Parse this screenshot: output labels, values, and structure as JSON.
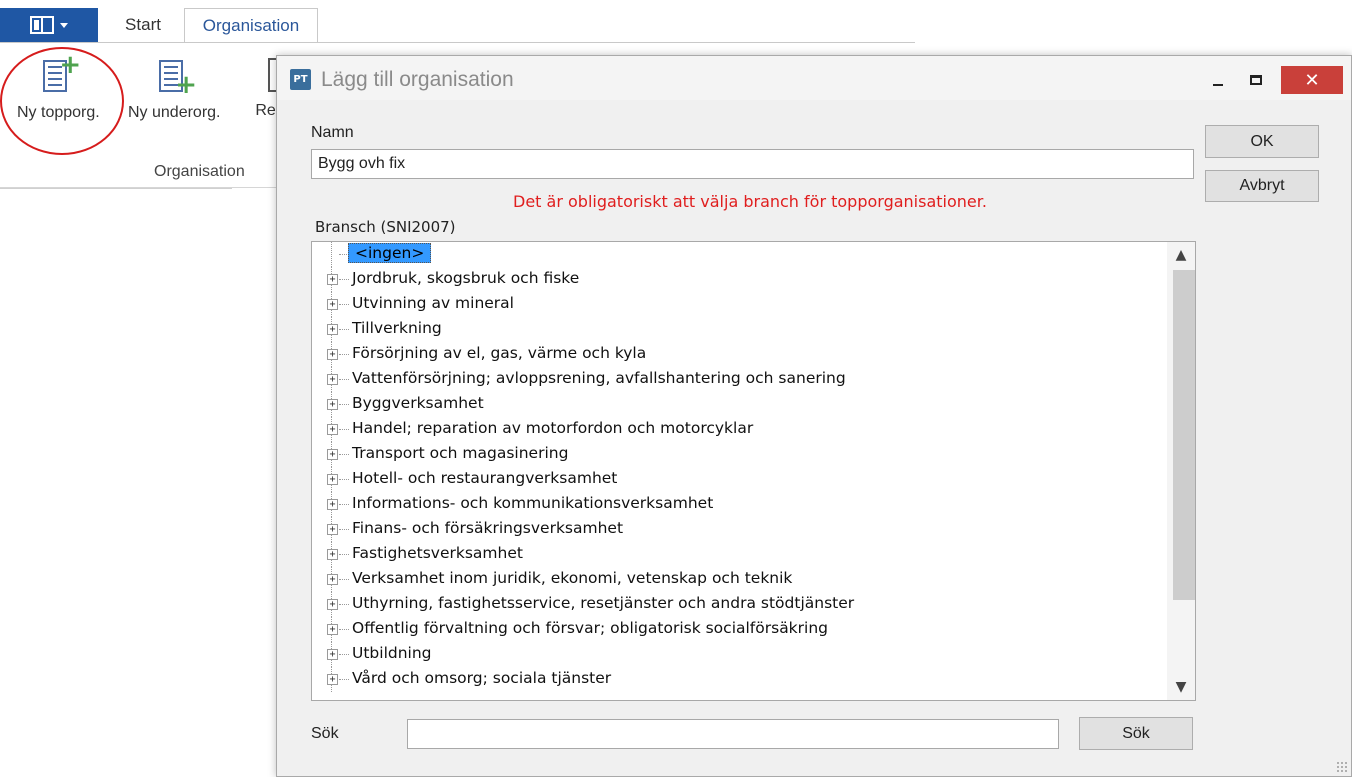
{
  "ribbon": {
    "tabs": [
      {
        "label": "Start"
      },
      {
        "label": "Organisation"
      }
    ],
    "buttons": {
      "ny_topporg": "Ny topporg.",
      "ny_underorg": "Ny underorg.",
      "redigera": "Red"
    },
    "group_label": "Organisation"
  },
  "dialog": {
    "title": "Lägg till organisation",
    "app_icon_text": "PT",
    "close_glyph": "✕",
    "namn_label": "Namn",
    "namn_value": "Bygg ovh fix",
    "error_message": "Det är obligatoriskt att välja branch för topporganisationer.",
    "bransch_label": "Bransch (SNI2007)",
    "tree_items": [
      {
        "label": "<ingen>",
        "selected": true
      },
      {
        "label": "Jordbruk, skogsbruk och fiske"
      },
      {
        "label": "Utvinning av mineral"
      },
      {
        "label": "Tillverkning"
      },
      {
        "label": "Försörjning av el, gas, värme och kyla"
      },
      {
        "label": "Vattenförsörjning; avloppsrening, avfallshantering och sanering"
      },
      {
        "label": "Byggverksamhet"
      },
      {
        "label": "Handel; reparation av motorfordon och motorcyklar"
      },
      {
        "label": "Transport och magasinering"
      },
      {
        "label": "Hotell- och restaurangverksamhet"
      },
      {
        "label": "Informations- och kommunikationsverksamhet"
      },
      {
        "label": "Finans- och försäkringsverksamhet"
      },
      {
        "label": "Fastighetsverksamhet"
      },
      {
        "label": "Verksamhet inom juridik, ekonomi, vetenskap och teknik"
      },
      {
        "label": "Uthyrning, fastighetsservice, resetjänster och andra stödtjänster"
      },
      {
        "label": "Offentlig förvaltning och försvar; obligatorisk socialförsäkring"
      },
      {
        "label": "Utbildning"
      },
      {
        "label": "Vård och omsorg; sociala tjänster"
      }
    ],
    "sok_label": "Sök",
    "sok_value": "",
    "sok_button": "Sök",
    "ok_button": "OK",
    "avbryt_button": "Avbryt"
  },
  "colors": {
    "accent_blue": "#1f57a4",
    "close_red": "#c9403a",
    "error_red": "#e01e1e",
    "selection_blue": "#3399ff",
    "highlight_circle": "#d61c1c"
  }
}
